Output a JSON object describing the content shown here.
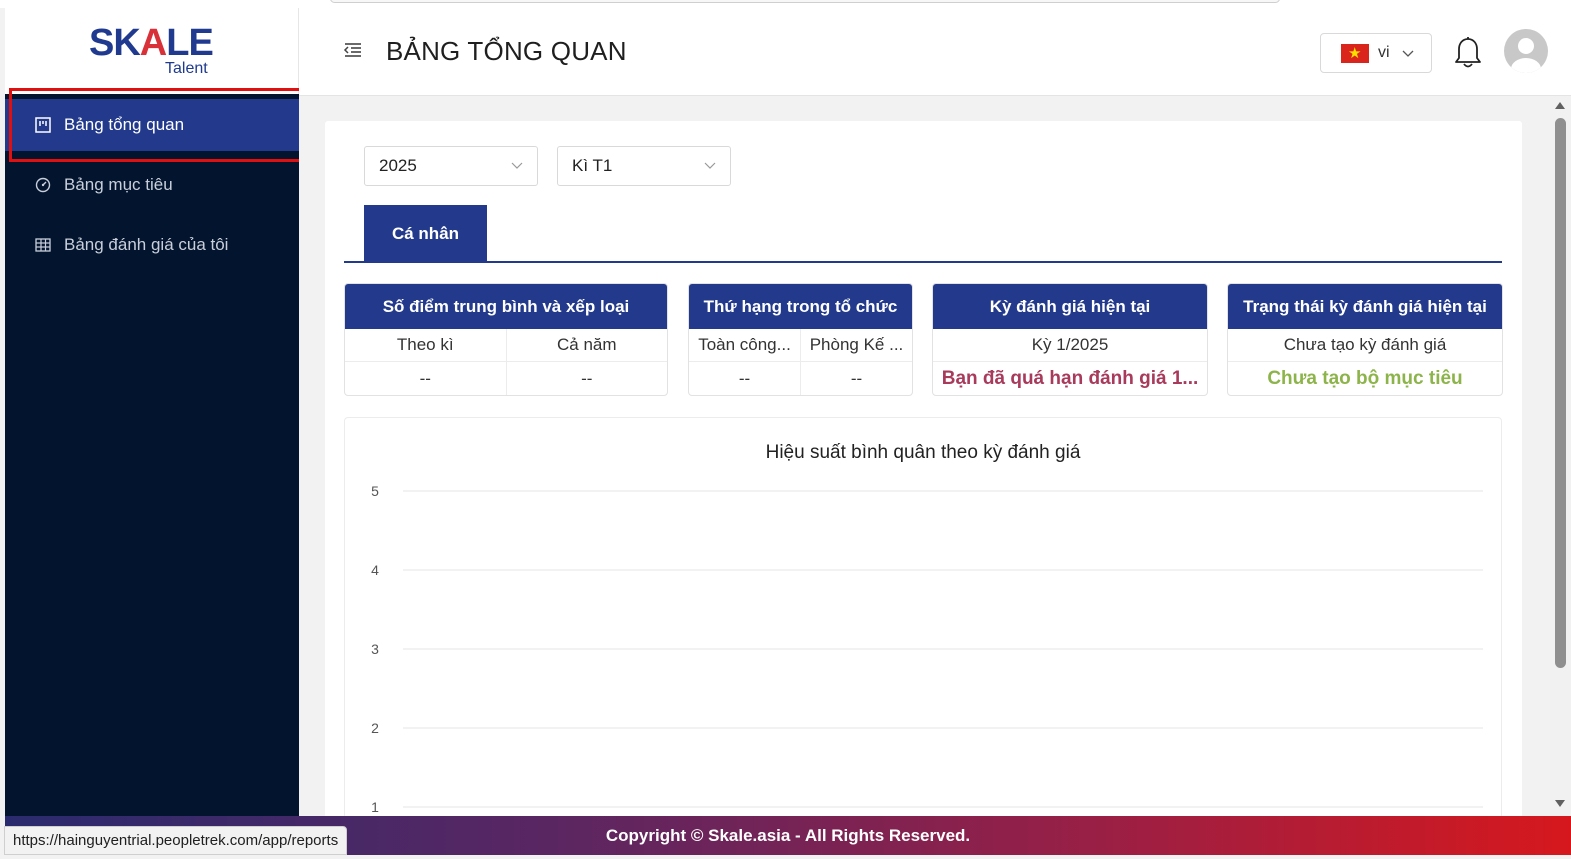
{
  "brand": {
    "logo_main_left": "SK",
    "logo_main_a": "A",
    "logo_main_right": "LE",
    "logo_sub": "Talent"
  },
  "sidebar": {
    "items": [
      {
        "label": "Bảng tổng quan",
        "icon": "dashboard-icon",
        "active": true
      },
      {
        "label": "Bảng mục tiêu",
        "icon": "gauge-icon",
        "active": false
      },
      {
        "label": "Bảng đánh giá của tôi",
        "icon": "table-icon",
        "active": false
      }
    ]
  },
  "header": {
    "title": "BẢNG TỔNG QUAN",
    "language": "vi"
  },
  "filters": {
    "year": "2025",
    "period": "Kì T1"
  },
  "tabs": [
    {
      "label": "Cá nhân"
    }
  ],
  "stats": {
    "average": {
      "title": "Số điểm trung bình và xếp loại",
      "col1": "Theo kì",
      "col2": "Cả năm",
      "val1": "--",
      "val2": "--"
    },
    "rank": {
      "title": "Thứ hạng trong tổ chức",
      "col1": "Toàn công...",
      "col2": "Phòng Kế ...",
      "val1": "--",
      "val2": "--"
    },
    "current_period": {
      "title": "Kỳ đánh giá hiện tại",
      "row1": "Kỳ 1/2025",
      "row2": "Bạn đã quá hạn đánh giá 1..."
    },
    "current_status": {
      "title": "Trạng thái kỳ đánh giá hiện tại",
      "row1": "Chưa tạo kỳ đánh giá",
      "row2": "Chưa tạo bộ mục tiêu"
    }
  },
  "chart_data": {
    "type": "line",
    "title": "Hiệu suất bình quân theo kỳ đánh giá",
    "y_ticks": [
      5,
      4,
      3,
      2,
      1
    ],
    "ylim": [
      1,
      5
    ],
    "series": [],
    "grid": true
  },
  "colors": {
    "primary": "#233a8c",
    "sidebar": "#03142e",
    "warn": "#a83a5c",
    "ok": "#8db44a",
    "highlight": "#e01010"
  },
  "footer": {
    "copyright": "Copyright © Skale.asia - All Rights Reserved."
  },
  "status_bar": {
    "url": "https://hainguyentrial.peopletrek.com/app/reports"
  }
}
